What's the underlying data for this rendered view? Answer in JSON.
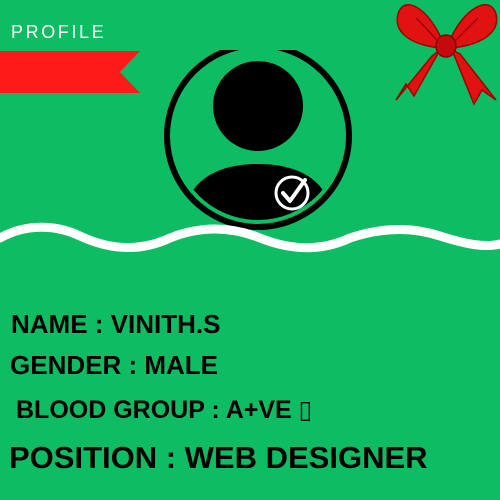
{
  "header": {
    "title": "PROFILE"
  },
  "icons": {
    "tag": "red-ribbon-tag-icon",
    "bow": "red-bow-icon",
    "avatar": "user-avatar-icon",
    "check": "checkmark-badge-icon",
    "wave": "wave-divider"
  },
  "colors": {
    "background": "#0dbc63",
    "accent": "#ff1a1a",
    "text": "#000000",
    "title": "#ffffff"
  },
  "profile": {
    "name": "NAME : VINITH.S",
    "gender": "GENDER : MALE",
    "blood_group": "BLOOD GROUP : A+VE ▯",
    "position": "POSITION : WEB DESIGNER"
  }
}
